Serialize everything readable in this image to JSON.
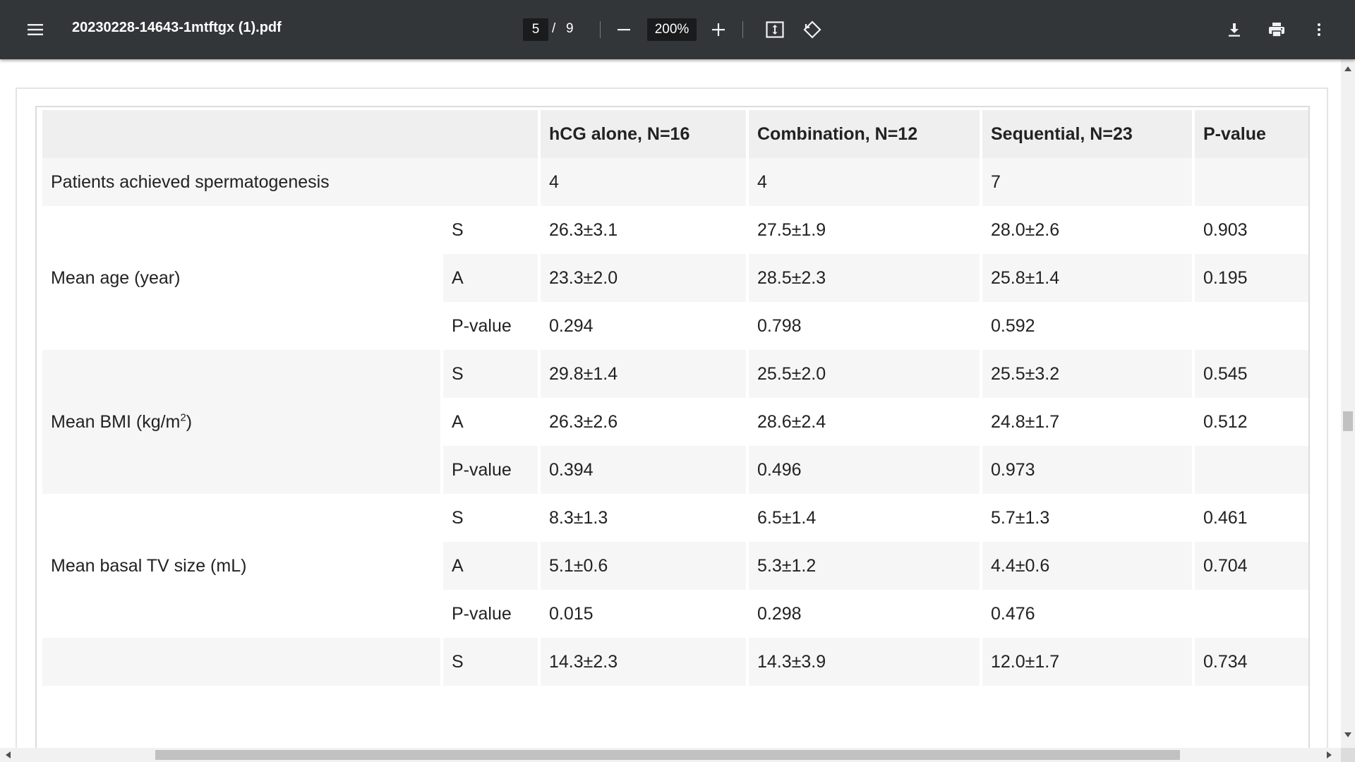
{
  "toolbar": {
    "menu_icon": "hamburger-menu-icon",
    "title": "20230228-14643-1mtftgx (1).pdf",
    "page_current": "5",
    "page_separator": "/",
    "page_total": "9",
    "zoom_value": "200%",
    "icons": {
      "zoom_out": "minus-icon",
      "zoom_in": "plus-icon",
      "fit": "fit-to-page-icon",
      "rotate": "rotate-counterclockwise-icon",
      "download": "download-icon",
      "print": "print-icon",
      "more": "more-vert-icon"
    },
    "colors": {
      "background": "#323639",
      "text": "#f1f1f1",
      "input_bg": "#191b1c"
    }
  },
  "table": {
    "headers": [
      "",
      "",
      "hCG alone, N=16",
      "Combination, N=12",
      "Sequential, N=23",
      "P-value"
    ],
    "row_spermatogenesis": {
      "label": "Patients achieved spermatogenesis",
      "hcg": "4",
      "combination": "4",
      "sequential": "7",
      "p": ""
    },
    "groups": [
      {
        "label": "Mean age (year)",
        "rows": [
          {
            "sub": "S",
            "hcg": "26.3±3.1",
            "combination": "27.5±1.9",
            "sequential": "28.0±2.6",
            "p": "0.903"
          },
          {
            "sub": "A",
            "hcg": "23.3±2.0",
            "combination": "28.5±2.3",
            "sequential": "25.8±1.4",
            "p": "0.195"
          },
          {
            "sub": "P-value",
            "hcg": "0.294",
            "combination": "0.798",
            "sequential": "0.592",
            "p": ""
          }
        ]
      },
      {
        "label": "Mean BMI (kg/m",
        "label_sup": "2",
        "label_suffix": ")",
        "rows": [
          {
            "sub": "S",
            "hcg": "29.8±1.4",
            "combination": "25.5±2.0",
            "sequential": "25.5±3.2",
            "p": "0.545"
          },
          {
            "sub": "A",
            "hcg": "26.3±2.6",
            "combination": "28.6±2.4",
            "sequential": "24.8±1.7",
            "p": "0.512"
          },
          {
            "sub": "P-value",
            "hcg": "0.394",
            "combination": "0.496",
            "sequential": "0.973",
            "p": ""
          }
        ]
      },
      {
        "label": "Mean basal TV size (mL)",
        "rows": [
          {
            "sub": "S",
            "hcg": "8.3±1.3",
            "combination": "6.5±1.4",
            "sequential": "5.7±1.3",
            "p": "0.461"
          },
          {
            "sub": "A",
            "hcg": "5.1±0.6",
            "combination": "5.3±1.2",
            "sequential": "4.4±0.6",
            "p": "0.704"
          },
          {
            "sub": "P-value",
            "hcg": "0.015",
            "combination": "0.298",
            "sequential": "0.476",
            "p": ""
          }
        ]
      },
      {
        "label": "",
        "rows": [
          {
            "sub": "S",
            "hcg": "14.3±2.3",
            "combination": "14.3±3.9",
            "sequential": "12.0±1.7",
            "p": "0.734"
          }
        ]
      }
    ]
  }
}
